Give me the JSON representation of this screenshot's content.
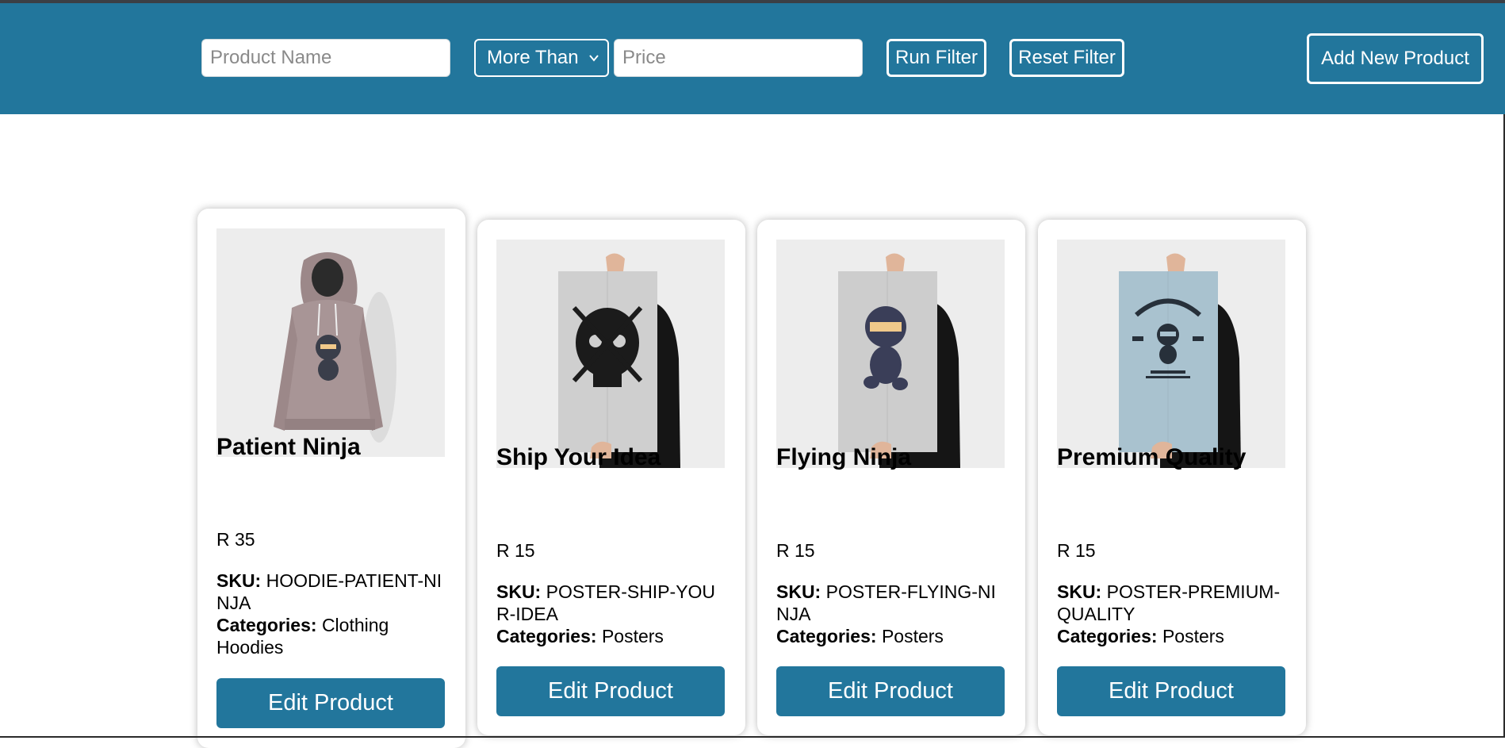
{
  "filter": {
    "name_placeholder": "Product Name",
    "comparison_selected": "More Than",
    "price_placeholder": "Price",
    "run_label": "Run Filter",
    "reset_label": "Reset Filter",
    "add_label": "Add New Product"
  },
  "colors": {
    "header": "#22769c",
    "button": "#22769c",
    "accent_text": "#ffffff"
  },
  "products": [
    {
      "name": "Patient Ninja",
      "price": "R 35",
      "sku_label": "SKU:",
      "sku": "HOODIE-PATIENT-NINJA",
      "categories_label": "Categories:",
      "categories": "Clothing Hoodies",
      "edit_label": "Edit Product",
      "image": "hoodie-ninja-image"
    },
    {
      "name": "Ship Your Idea",
      "price": "R 15",
      "sku_label": "SKU:",
      "sku": "POSTER-SHIP-YOUR-IDEA",
      "categories_label": "Categories:",
      "categories": "Posters",
      "edit_label": "Edit Product",
      "image": "poster-ship-your-idea-image"
    },
    {
      "name": "Flying Ninja",
      "price": "R 15",
      "sku_label": "SKU:",
      "sku": "POSTER-FLYING-NINJA",
      "categories_label": "Categories:",
      "categories": "Posters",
      "edit_label": "Edit Product",
      "image": "poster-flying-ninja-image"
    },
    {
      "name": "Premium Quality",
      "price": "R 15",
      "sku_label": "SKU:",
      "sku": "POSTER-PREMIUM-QUALITY",
      "categories_label": "Categories:",
      "categories": "Posters",
      "edit_label": "Edit Product",
      "image": "poster-premium-quality-image"
    }
  ]
}
